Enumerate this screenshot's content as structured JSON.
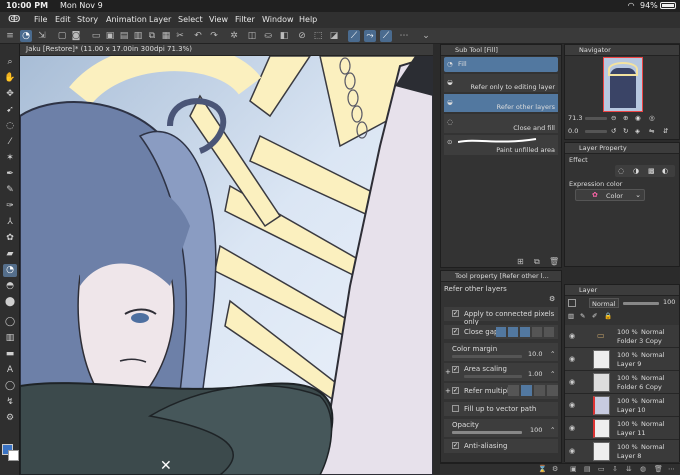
{
  "status": {
    "time": "10:00 PM",
    "date": "Mon Nov 9",
    "battery": "94%"
  },
  "menu": [
    "File",
    "Edit",
    "Story",
    "Animation",
    "Layer",
    "Select",
    "View",
    "Filter",
    "Window",
    "Help"
  ],
  "canvas": {
    "tab_title": "Jaku [Restore]* (11.00 x 17.00in 300dpi 71.3%)"
  },
  "subtool": {
    "title": "Sub Tool [Fill]",
    "items": [
      "Fill",
      "Refer only to editing layer",
      "Refer other layers",
      "Close and fill",
      "Paint unfilled area"
    ],
    "selected": "Refer other layers"
  },
  "navigator": {
    "title": "Navigator",
    "zoom": "71.3",
    "angle": "0.0"
  },
  "layer_property": {
    "title": "Layer Property",
    "effect_label": "Effect",
    "expression_label": "Expression color",
    "expression_value": "Color"
  },
  "tool_property": {
    "title": "Tool property [Refer other l...",
    "subtitle": "Refer other layers",
    "apply_connected": "Apply to connected pixels only",
    "close_gap": "Close gap",
    "color_margin": "Color margin",
    "color_margin_value": "10.0",
    "area_scaling": "Area scaling",
    "area_scaling_value": "1.00",
    "refer_multiple": "Refer multiple",
    "fill_vector": "Fill up to vector path",
    "opacity": "Opacity",
    "opacity_value": "100",
    "anti_aliasing": "Anti-aliasing"
  },
  "layer_panel": {
    "title": "Layer",
    "blend": "Normal",
    "opacity": "100",
    "layers": [
      {
        "pct": "100 %",
        "mode": "Normal",
        "name": "Folder 3 Copy",
        "folder": true
      },
      {
        "pct": "100 %",
        "mode": "Normal",
        "name": "Layer 9",
        "folder": false
      },
      {
        "pct": "100 %",
        "mode": "Normal",
        "name": "Folder 6 Copy",
        "folder": true
      },
      {
        "pct": "100 %",
        "mode": "Normal",
        "name": "Layer 10",
        "folder": false
      },
      {
        "pct": "100 %",
        "mode": "Normal",
        "name": "Layer 11",
        "folder": false
      },
      {
        "pct": "100 %",
        "mode": "Normal",
        "name": "Layer 8",
        "folder": false
      }
    ]
  },
  "colors": {
    "accent": "#5278a0",
    "main_color": "#3a73c4",
    "sub_color": "#ffffff"
  }
}
